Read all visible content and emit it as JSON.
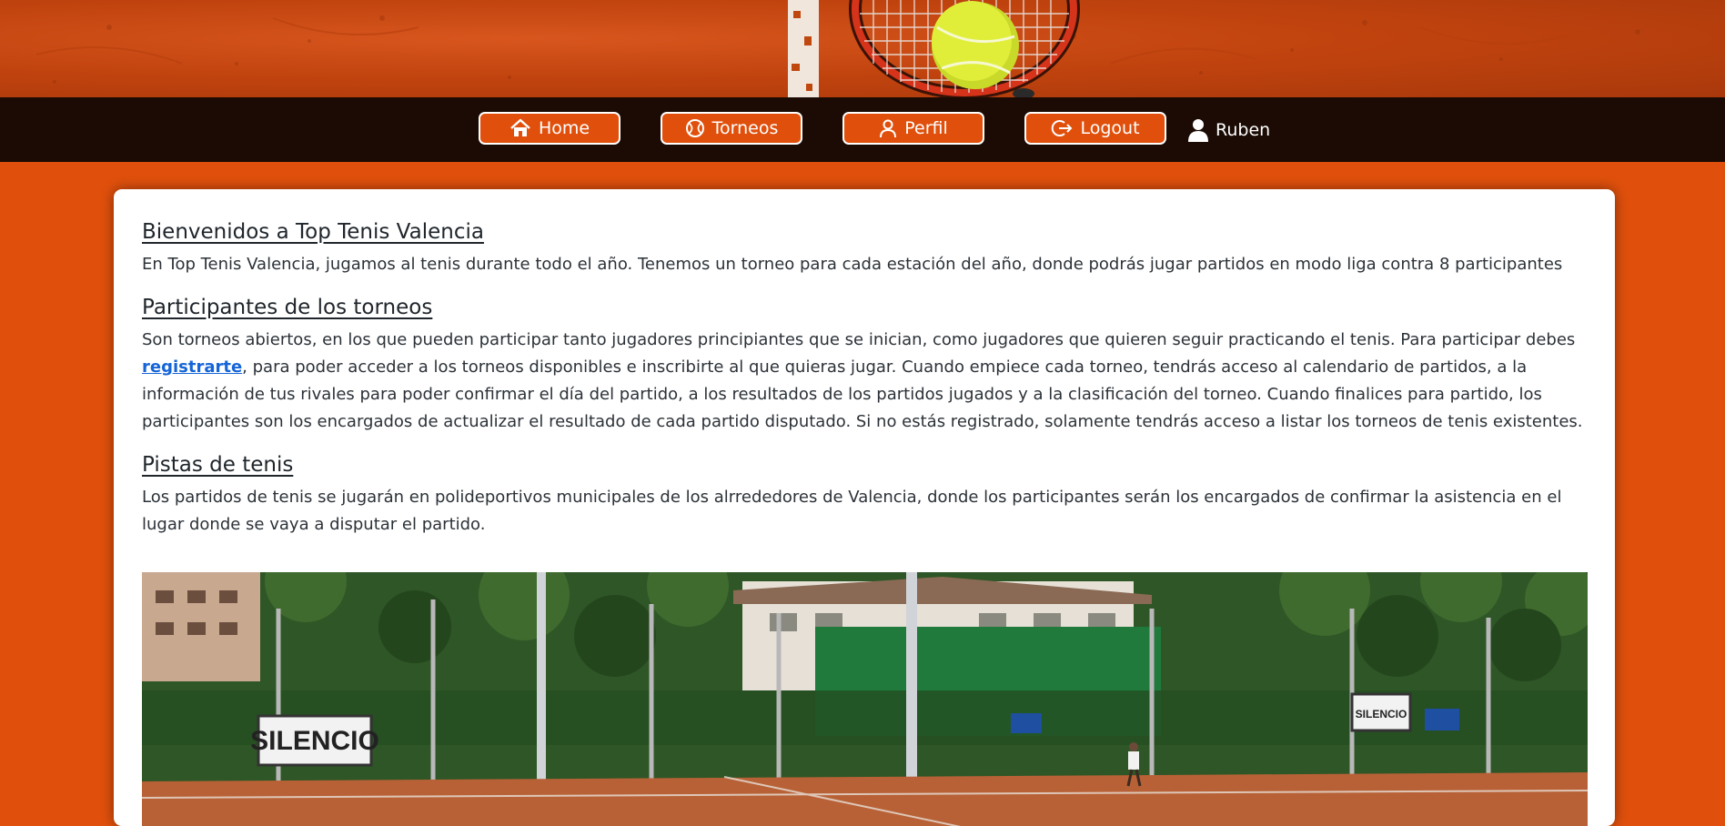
{
  "nav": {
    "buttons": [
      {
        "label": "Home",
        "icon": "home-icon"
      },
      {
        "label": "Torneos",
        "icon": "tennis-ball-icon"
      },
      {
        "label": "Perfil",
        "icon": "user-outline-icon"
      },
      {
        "label": "Logout",
        "icon": "logout-icon"
      }
    ],
    "username": "Ruben"
  },
  "main": {
    "sections": [
      {
        "title": "Bienvenidos a Top Tenis Valencia",
        "text": "En Top Tenis Valencia, jugamos al tenis durante todo el año. Tenemos un torneo para cada estación del año, donde podrás jugar partidos en modo liga contra 8 participantes"
      },
      {
        "title": "Participantes de los torneos",
        "text_before_link": "Son torneos abiertos, en los que pueden participar tanto jugadores principiantes que se inician, como jugadores que quieren seguir practicando el tenis. Para participar debes ",
        "link_label": "registrarte",
        "text_after_link": ", para poder acceder a los torneos disponibles e inscribirte al que quieras jugar. Cuando empiece cada torneo, tendrás acceso al calendario de partidos, a la información de tus rivales para poder confirmar el día del partido, a los resultados de los partidos jugados y a la clasificación del torneo. Cuando finalices para partido, los participantes son los encargados de actualizar el resultado de cada partido disputado. Si no estás registrado, solamente tendrás acceso a listar los torneos de tenis existentes."
      },
      {
        "title": "Pistas de tenis",
        "text": "Los partidos de tenis se jugarán en polideportivos municipales de los alrrededores de Valencia, donde los participantes serán los encargados de confirmar la asistencia en el lugar donde se vaya a disputar el partido."
      }
    ],
    "photo_signs": [
      "SILENCIO",
      "SILENCIO"
    ]
  },
  "colors": {
    "accent": "#e0500c",
    "navbar": "#1b0b04",
    "link": "#1565d8"
  }
}
